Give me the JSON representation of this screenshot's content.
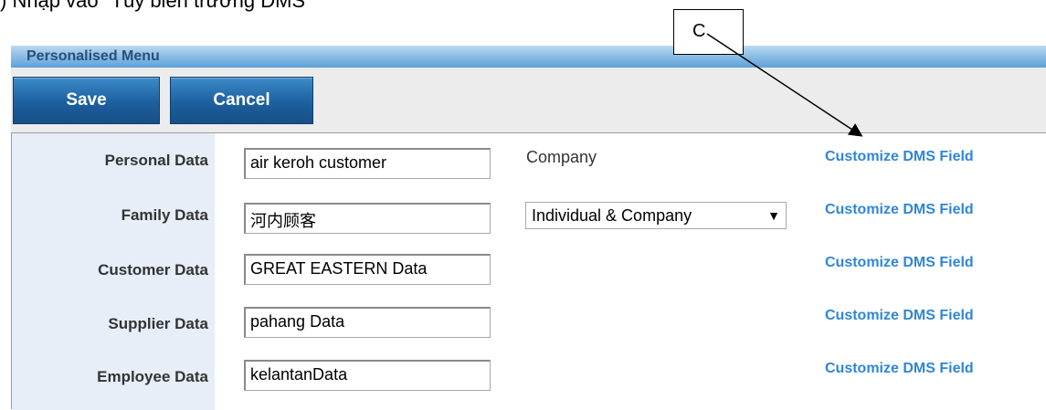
{
  "document": {
    "caption": ") Nhập vào \"Tùy biến trường DMS\"",
    "callout_label": "C"
  },
  "panel": {
    "title": "Personalised Menu",
    "title_bar_color": "#5fa1d8"
  },
  "toolbar": {
    "save_label": "Save",
    "cancel_label": "Cancel",
    "button_color": "#1d5f9f"
  },
  "company": {
    "label": "Company",
    "selected_option": "Individual & Company",
    "dropdown_icon": "triangle-down-icon"
  },
  "rows": [
    {
      "label": "Personal Data",
      "value": "air keroh customer",
      "link": "Customize DMS Field"
    },
    {
      "label": "Family Data",
      "value": "河内顾客",
      "link": "Customize DMS Field"
    },
    {
      "label": "Customer Data",
      "value": "GREAT EASTERN Data",
      "link": "Customize DMS Field"
    },
    {
      "label": "Supplier Data",
      "value": "pahang Data",
      "link": "Customize DMS Field"
    },
    {
      "label": "Employee Data",
      "value": "kelantanData",
      "link": "Customize DMS Field"
    }
  ],
  "colors": {
    "label_column_bg": "#e7eef8",
    "link_color": "#2f86d6"
  }
}
